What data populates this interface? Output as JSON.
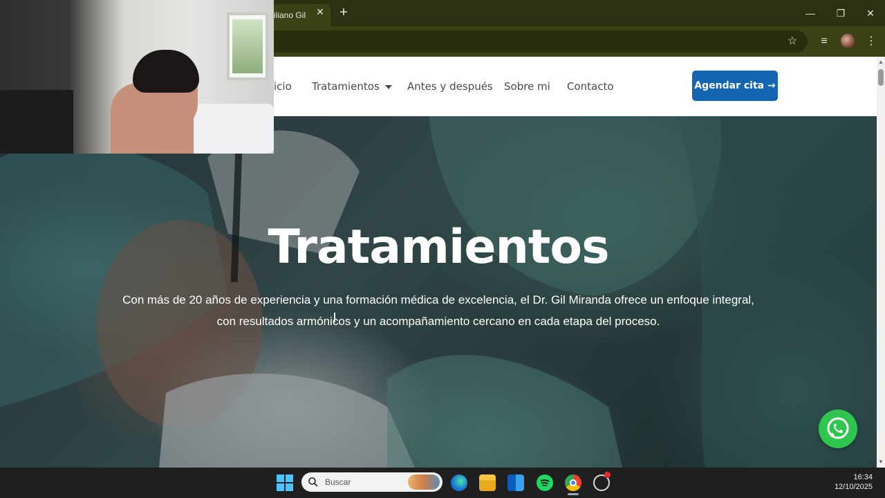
{
  "browser": {
    "tab_title": "iliano Gil",
    "tab_close": "✕",
    "new_tab": "+",
    "window_controls": [
      "—",
      "❐",
      "✕"
    ],
    "toolbar_icons": [
      "star-icon",
      "media-control-icon",
      "profile-avatar",
      "menu-kebab-icon"
    ]
  },
  "site": {
    "nav": {
      "items": [
        "icio",
        "Tratamientos",
        "Antes y después",
        "Sobre mi",
        "Contacto"
      ],
      "cta": "Agendar cita →"
    },
    "hero": {
      "title": "Tratamientos",
      "subtitle_line1": "Con más de 20 años de experiencia y una formación médica de excelencia, el Dr. Gil Miranda ofrece un enfoque integral,",
      "subtitle_line2": "con resultados armónicos y un acompañamiento cercano en cada etapa del proceso."
    },
    "whatsapp": "whatsapp-icon"
  },
  "taskbar": {
    "search_placeholder": "Buscar",
    "apps": [
      "windows-start-icon",
      "edge-icon",
      "file-explorer-icon",
      "outlook-icon",
      "spotify-icon",
      "chrome-icon",
      "chatgpt-icon"
    ],
    "time": "16:34",
    "date": "12/10/2025"
  },
  "colors": {
    "accent_blue": "#1566b0",
    "whatsapp_green": "#2fc54f",
    "browser_frame": "#3d4216"
  }
}
